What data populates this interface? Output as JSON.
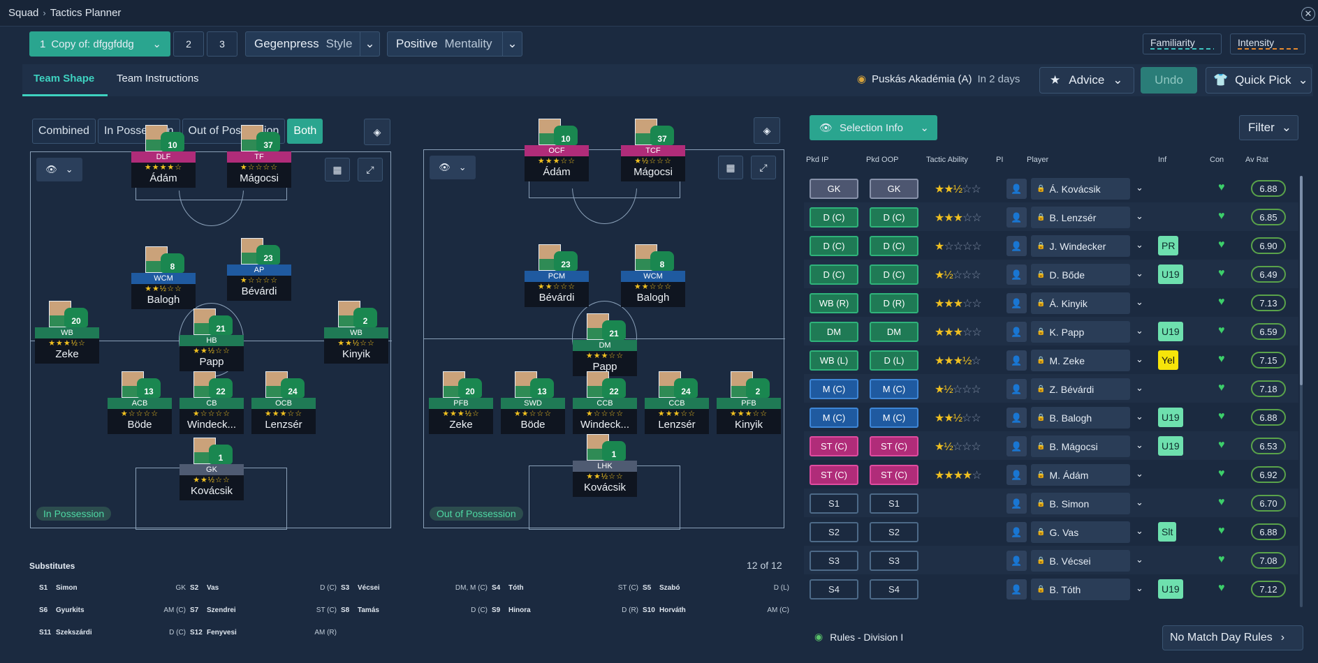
{
  "breadcrumb": {
    "root": "Squad",
    "current": "Tactics Planner"
  },
  "tactic_tabs": {
    "active_num": "1",
    "active_name": "Copy of: dfggfddg",
    "tab2": "2",
    "tab3": "3"
  },
  "style": {
    "value": "Gegenpress",
    "label": "Style"
  },
  "mentality": {
    "value": "Positive",
    "label": "Mentality"
  },
  "meters": {
    "familiarity": "Familiarity",
    "intensity": "Intensity"
  },
  "subnav": {
    "team_shape": "Team Shape",
    "team_instructions": "Team Instructions"
  },
  "opponent": {
    "name": "Puskás Akadémia (A)",
    "when": "In 2 days"
  },
  "actions": {
    "advice": "Advice",
    "undo": "Undo",
    "quick_pick": "Quick Pick"
  },
  "view_modes": [
    "Combined",
    "In Possession",
    "Out of Possession",
    "Both"
  ],
  "view_selected": "Both",
  "pitch_labels": {
    "in": "In Possession",
    "out": "Out of Possession"
  },
  "in_possession": [
    {
      "role": "DLF",
      "stars": "★★★★☆",
      "name": "Ádám",
      "num": "10",
      "color": "pink"
    },
    {
      "role": "TF",
      "stars": "★☆☆☆☆",
      "name": "Mágocsi",
      "num": "37",
      "color": "pink"
    },
    {
      "role": "WCM",
      "stars": "★★½☆☆",
      "name": "Balogh",
      "num": "8",
      "color": "blue"
    },
    {
      "role": "AP",
      "stars": "★☆☆☆☆",
      "name": "Bévárdi",
      "num": "23",
      "color": "blue"
    },
    {
      "role": "WB",
      "stars": "★★★½☆",
      "name": "Zeke",
      "num": "20",
      "color": "green"
    },
    {
      "role": "HB",
      "stars": "★★½☆☆",
      "name": "Papp",
      "num": "21",
      "color": "green"
    },
    {
      "role": "WB",
      "stars": "★★½☆☆",
      "name": "Kinyik",
      "num": "2",
      "color": "green"
    },
    {
      "role": "ACB",
      "stars": "★☆☆☆☆",
      "name": "Böde",
      "num": "13",
      "color": "green"
    },
    {
      "role": "CB",
      "stars": "★☆☆☆☆",
      "name": "Windeck...",
      "num": "22",
      "color": "green"
    },
    {
      "role": "OCB",
      "stars": "★★★☆☆",
      "name": "Lenzsér",
      "num": "24",
      "color": "green"
    },
    {
      "role": "GK",
      "stars": "★★½☆☆",
      "name": "Kovácsik",
      "num": "1",
      "color": "gray"
    }
  ],
  "out_possession": [
    {
      "role": "OCF",
      "stars": "★★★☆☆",
      "name": "Ádám",
      "num": "10",
      "color": "pink"
    },
    {
      "role": "TCF",
      "stars": "★½☆☆☆",
      "name": "Mágocsi",
      "num": "37",
      "color": "pink"
    },
    {
      "role": "PCM",
      "stars": "★★☆☆☆",
      "name": "Bévárdi",
      "num": "23",
      "color": "blue"
    },
    {
      "role": "WCM",
      "stars": "★★☆☆☆",
      "name": "Balogh",
      "num": "8",
      "color": "blue"
    },
    {
      "role": "DM",
      "stars": "★★★☆☆",
      "name": "Papp",
      "num": "21",
      "color": "green"
    },
    {
      "role": "PFB",
      "stars": "★★★½☆",
      "name": "Zeke",
      "num": "20",
      "color": "green"
    },
    {
      "role": "SWD",
      "stars": "★★☆☆☆",
      "name": "Böde",
      "num": "13",
      "color": "green"
    },
    {
      "role": "CCB",
      "stars": "★☆☆☆☆",
      "name": "Windeck...",
      "num": "22",
      "color": "green"
    },
    {
      "role": "CCB",
      "stars": "★★★☆☆",
      "name": "Lenzsér",
      "num": "24",
      "color": "green"
    },
    {
      "role": "PFB",
      "stars": "★★★☆☆",
      "name": "Kinyik",
      "num": "2",
      "color": "green"
    },
    {
      "role": "LHK",
      "stars": "★★½☆☆",
      "name": "Kovácsik",
      "num": "1",
      "color": "gray"
    }
  ],
  "substitutes": {
    "title": "Substitutes",
    "count": "12 of 12",
    "list": [
      {
        "slot": "S1",
        "name": "Simon",
        "pos": "GK"
      },
      {
        "slot": "S2",
        "name": "Vas",
        "pos": "D (C)"
      },
      {
        "slot": "S3",
        "name": "Vécsei",
        "pos": "DM, M (C)"
      },
      {
        "slot": "S4",
        "name": "Tóth",
        "pos": "ST (C)"
      },
      {
        "slot": "S5",
        "name": "Szabó",
        "pos": "D (L)"
      },
      {
        "slot": "S6",
        "name": "Gyurkits",
        "pos": "AM (C)"
      },
      {
        "slot": "S7",
        "name": "Szendrei",
        "pos": "ST (C)"
      },
      {
        "slot": "S8",
        "name": "Tamás",
        "pos": "D (C)"
      },
      {
        "slot": "S9",
        "name": "Hinora",
        "pos": "D (R)"
      },
      {
        "slot": "S10",
        "name": "Horváth",
        "pos": "AM (C)"
      },
      {
        "slot": "S11",
        "name": "Szekszárdi",
        "pos": "D (C)"
      },
      {
        "slot": "S12",
        "name": "Fenyvesi",
        "pos": "AM (R)"
      }
    ]
  },
  "selection": {
    "info_label": "Selection Info",
    "filter_label": "Filter"
  },
  "table_headers": {
    "pkd_ip": "Pkd IP",
    "pkd_oop": "Pkd OOP",
    "tactic": "Tactic Ability",
    "pi": "PI",
    "player": "Player",
    "inf": "Inf",
    "con": "Con",
    "av": "Av Rat"
  },
  "selection_rows": [
    {
      "ip": "GK",
      "oop": "GK",
      "ipc": "gk",
      "oopc": "gk",
      "stars": "★★½☆☆",
      "player": "Á. Kovácsik",
      "inf": "",
      "rat": "6.88"
    },
    {
      "ip": "D (C)",
      "oop": "D (C)",
      "ipc": "def",
      "oopc": "def",
      "stars": "★★★☆☆",
      "player": "B. Lenzsér",
      "inf": "",
      "rat": "6.85"
    },
    {
      "ip": "D (C)",
      "oop": "D (C)",
      "ipc": "def",
      "oopc": "def",
      "stars": "★☆☆☆☆",
      "player": "J. Windecker",
      "inf": "PR",
      "rat": "6.90"
    },
    {
      "ip": "D (C)",
      "oop": "D (C)",
      "ipc": "def",
      "oopc": "def",
      "stars": "★½☆☆☆",
      "player": "D. Bőde",
      "inf": "U19",
      "rat": "6.49"
    },
    {
      "ip": "WB (R)",
      "oop": "D (R)",
      "ipc": "def",
      "oopc": "def",
      "stars": "★★★☆☆",
      "player": "Á. Kinyik",
      "inf": "",
      "rat": "7.13"
    },
    {
      "ip": "DM",
      "oop": "DM",
      "ipc": "def",
      "oopc": "def",
      "stars": "★★★☆☆",
      "player": "K. Papp",
      "inf": "U19",
      "rat": "6.59"
    },
    {
      "ip": "WB (L)",
      "oop": "D (L)",
      "ipc": "def",
      "oopc": "def",
      "stars": "★★★½☆",
      "player": "M. Zeke",
      "inf": "Yel",
      "rat": "7.15"
    },
    {
      "ip": "M (C)",
      "oop": "M (C)",
      "ipc": "mid",
      "oopc": "mid",
      "stars": "★½☆☆☆",
      "player": "Z. Bévárdi",
      "inf": "",
      "rat": "7.18"
    },
    {
      "ip": "M (C)",
      "oop": "M (C)",
      "ipc": "mid",
      "oopc": "mid",
      "stars": "★★½☆☆",
      "player": "B. Balogh",
      "inf": "U19",
      "rat": "6.88"
    },
    {
      "ip": "ST (C)",
      "oop": "ST (C)",
      "ipc": "st",
      "oopc": "st",
      "stars": "★½☆☆☆",
      "player": "B. Mágocsi",
      "inf": "U19",
      "rat": "6.53"
    },
    {
      "ip": "ST (C)",
      "oop": "ST (C)",
      "ipc": "st",
      "oopc": "st",
      "stars": "★★★★☆",
      "player": "M. Ádám",
      "inf": "",
      "rat": "6.92"
    },
    {
      "ip": "S1",
      "oop": "S1",
      "ipc": "sb",
      "oopc": "sb",
      "stars": "",
      "player": "B. Simon",
      "inf": "",
      "rat": "6.70"
    },
    {
      "ip": "S2",
      "oop": "S2",
      "ipc": "sb",
      "oopc": "sb",
      "stars": "",
      "player": "G. Vas",
      "inf": "Slt",
      "rat": "6.88"
    },
    {
      "ip": "S3",
      "oop": "S3",
      "ipc": "sb",
      "oopc": "sb",
      "stars": "",
      "player": "B. Vécsei",
      "inf": "",
      "rat": "7.08"
    },
    {
      "ip": "S4",
      "oop": "S4",
      "ipc": "sb",
      "oopc": "sb",
      "stars": "",
      "player": "B. Tóth",
      "inf": "U19",
      "rat": "7.12"
    }
  ],
  "footer": {
    "rules": "Rules - Division I",
    "match_day": "No Match Day Rules"
  },
  "colors": {
    "accent": "#2aa58f",
    "background": "#1b2a40",
    "star": "#f0c020"
  }
}
